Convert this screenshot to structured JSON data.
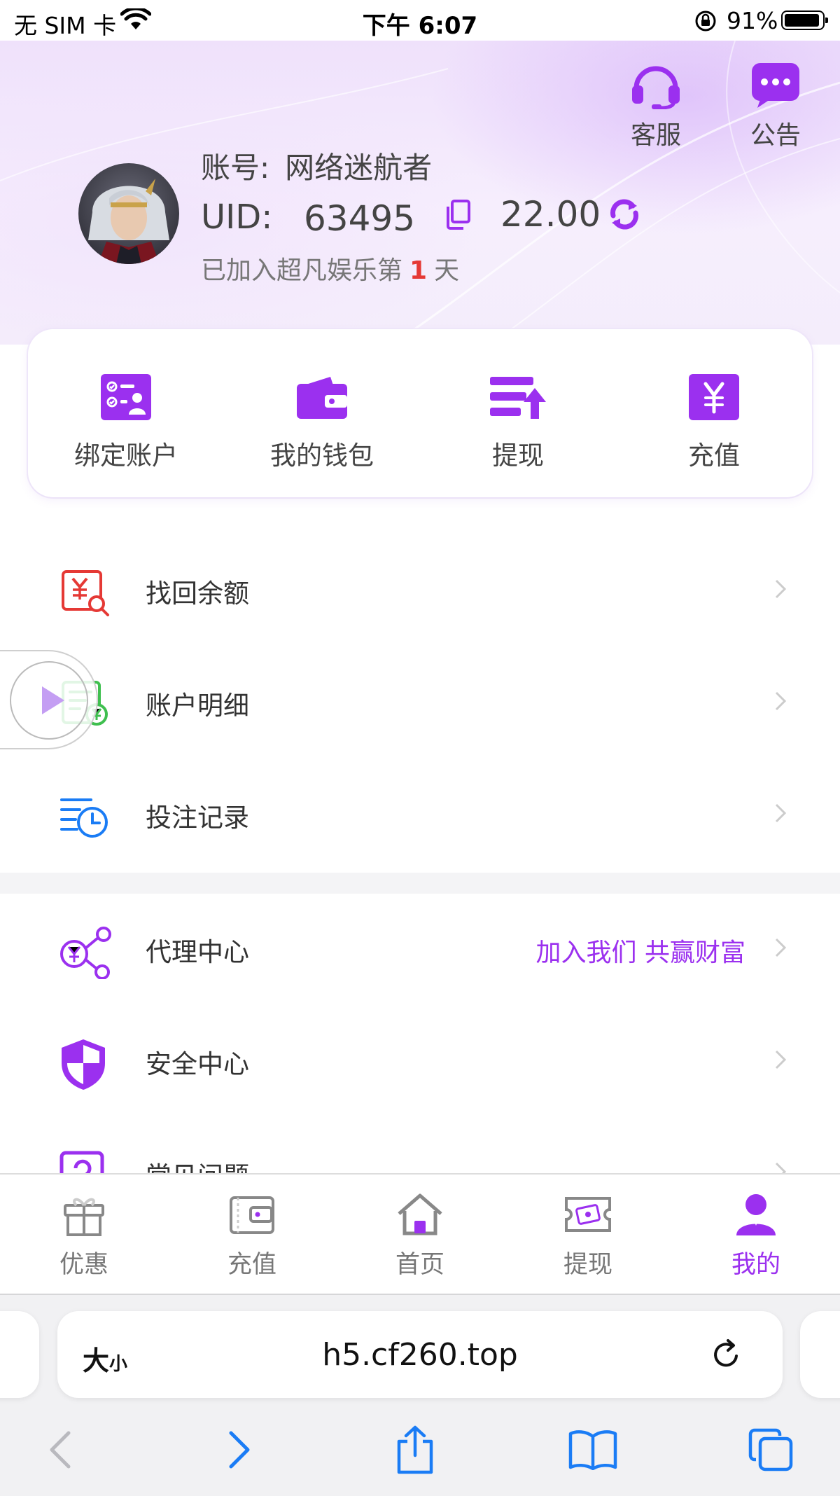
{
  "status_bar": {
    "carrier": "无 SIM 卡",
    "time": "下午 6:07",
    "battery": "91%"
  },
  "header": {
    "service_label": "客服",
    "notice_label": "公告",
    "account_label": "账号:",
    "account_name": "网络迷航者",
    "uid_label": "UID:",
    "uid_value": "63495",
    "balance": "22.00",
    "joined_prefix": "已加入超凡娱乐第",
    "joined_days": "1",
    "joined_suffix": "天"
  },
  "quick_actions": [
    {
      "label": "绑定账户",
      "icon": "bind-account-icon"
    },
    {
      "label": "我的钱包",
      "icon": "wallet-icon"
    },
    {
      "label": "提现",
      "icon": "withdraw-icon"
    },
    {
      "label": "充值",
      "icon": "recharge-yen-icon"
    }
  ],
  "menu": [
    {
      "label": "找回余额",
      "icon": "recover-balance-icon"
    },
    {
      "label": "账户明细",
      "icon": "account-details-icon"
    },
    {
      "label": "投注记录",
      "icon": "bet-record-icon"
    },
    {
      "label": "代理中心",
      "icon": "agent-icon",
      "extra": "加入我们 共赢财富"
    },
    {
      "label": "安全中心",
      "icon": "shield-icon"
    },
    {
      "label": "常见问题",
      "icon": "faq-icon"
    }
  ],
  "tab_bar": [
    {
      "label": "优惠",
      "icon": "gift-icon"
    },
    {
      "label": "充值",
      "icon": "wallet-tab-icon"
    },
    {
      "label": "首页",
      "icon": "home-icon"
    },
    {
      "label": "提现",
      "icon": "withdraw-tab-icon"
    },
    {
      "label": "我的",
      "icon": "user-icon",
      "active": true
    }
  ],
  "browser": {
    "text_size_big": "大",
    "text_size_small": "小",
    "url": "h5.cf260.top"
  },
  "colors": {
    "accent": "#9b30ef",
    "header_bg": "#efe1fb",
    "highlight_red": "#e53935",
    "ios_blue": "#1a7cf5"
  }
}
